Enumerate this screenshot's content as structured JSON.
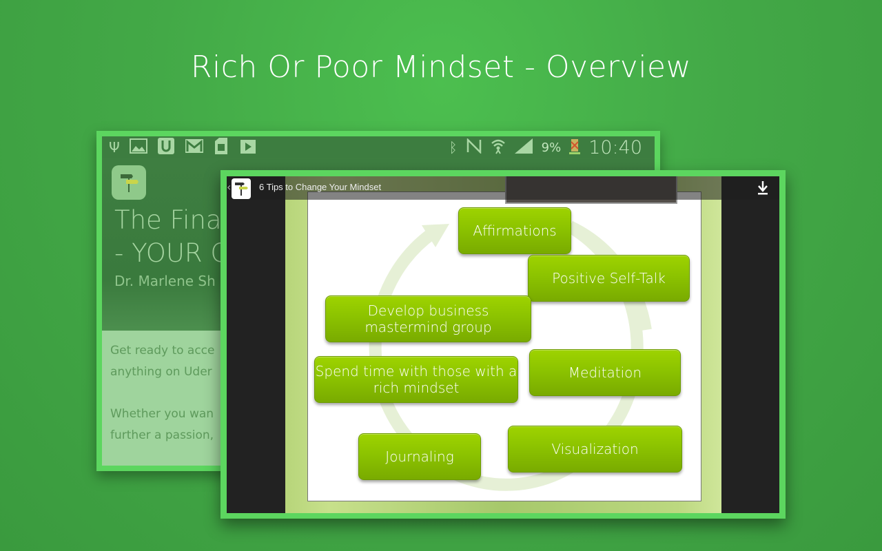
{
  "page": {
    "headline": "Rich Or Poor Mindset - Overview"
  },
  "back_screenshot": {
    "status_bar": {
      "left_icons": [
        "usb-icon",
        "image-icon",
        "udemy-u-icon",
        "gmail-icon",
        "sim-card-icon",
        "play-store-icon"
      ],
      "right_icons": [
        "bluetooth-icon",
        "nfc-icon",
        "wifi-icon",
        "signal-icon"
      ],
      "battery": "9%",
      "time": "10:40"
    },
    "course": {
      "title_line1": "The Fina",
      "title_line2": "- YOUR C",
      "author": "Dr. Marlene Sh"
    },
    "description": {
      "line1": "Get ready to acce",
      "line2": "anything on Uder",
      "line3": "Whether you wan",
      "line4": "further a passion,"
    }
  },
  "front_screenshot": {
    "video_title": "6  Tips to Change Your Mindset",
    "back_glyph": "‹",
    "slide": {
      "items": [
        {
          "label": "Affirmations"
        },
        {
          "label": "Positive Self-Talk"
        },
        {
          "label": "Develop business mastermind group"
        },
        {
          "label": "Meditation"
        },
        {
          "label": "Spend time with those with a rich mindset"
        },
        {
          "label": "Visualization"
        },
        {
          "label": "Journaling"
        }
      ]
    }
  },
  "colors": {
    "background": "#43a947",
    "frame": "#5cd65f",
    "box_green": "#8cc300"
  }
}
